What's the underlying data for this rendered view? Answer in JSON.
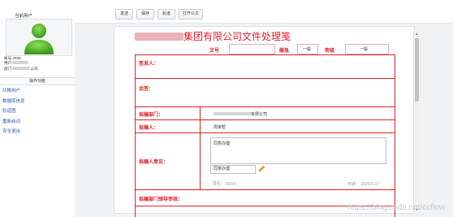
{
  "sidebar": {
    "title": "当前用户",
    "user": {
      "account_label": "帐号",
      "account_value": "2509",
      "username_label": "用户",
      "dept_label": "部门",
      "dept_value_tail": "公司"
    },
    "ops_title": "操作功能",
    "menu": [
      {
        "label": "切换用户"
      },
      {
        "label": "数据库信息"
      },
      {
        "label": "轨道图"
      },
      {
        "label": "重新启动"
      },
      {
        "label": "安全退出"
      }
    ]
  },
  "toolbar": {
    "buttons": [
      {
        "label": "发送"
      },
      {
        "label": "保存"
      },
      {
        "label": "轨道"
      },
      {
        "label": "打开公文"
      }
    ]
  },
  "document": {
    "title_suffix": "集团有限公司文件处理笺",
    "header_row": {
      "doc_no_label": "文号",
      "urgency_label": "缓急",
      "urgency_value": "一般",
      "secret_label": "密级",
      "secret_value": "一般"
    },
    "rows": {
      "issuer_label": "签发人：",
      "countersign_label": "会签：",
      "drafting_dept_label": "拟稿部门：",
      "drafting_dept_value_tail": "有限公司",
      "drafter_label": "拟稿人：",
      "drafter_value": "周家帮",
      "drafter_opinion_label": "拟稿人意见：",
      "opinion_text": "同意办理",
      "opinion_select": "同意办理",
      "sign_label": "签名：",
      "date_label": "日期：",
      "date_value": "2020-5-17",
      "leader_review_label": "拟稿部门领导审核："
    }
  },
  "watermark": "https://blog.csdn.net/ccflow",
  "colors": {
    "accent_red": "#e0202a",
    "link_blue": "#2a5aa8",
    "avatar_green": "#5cb82e"
  }
}
